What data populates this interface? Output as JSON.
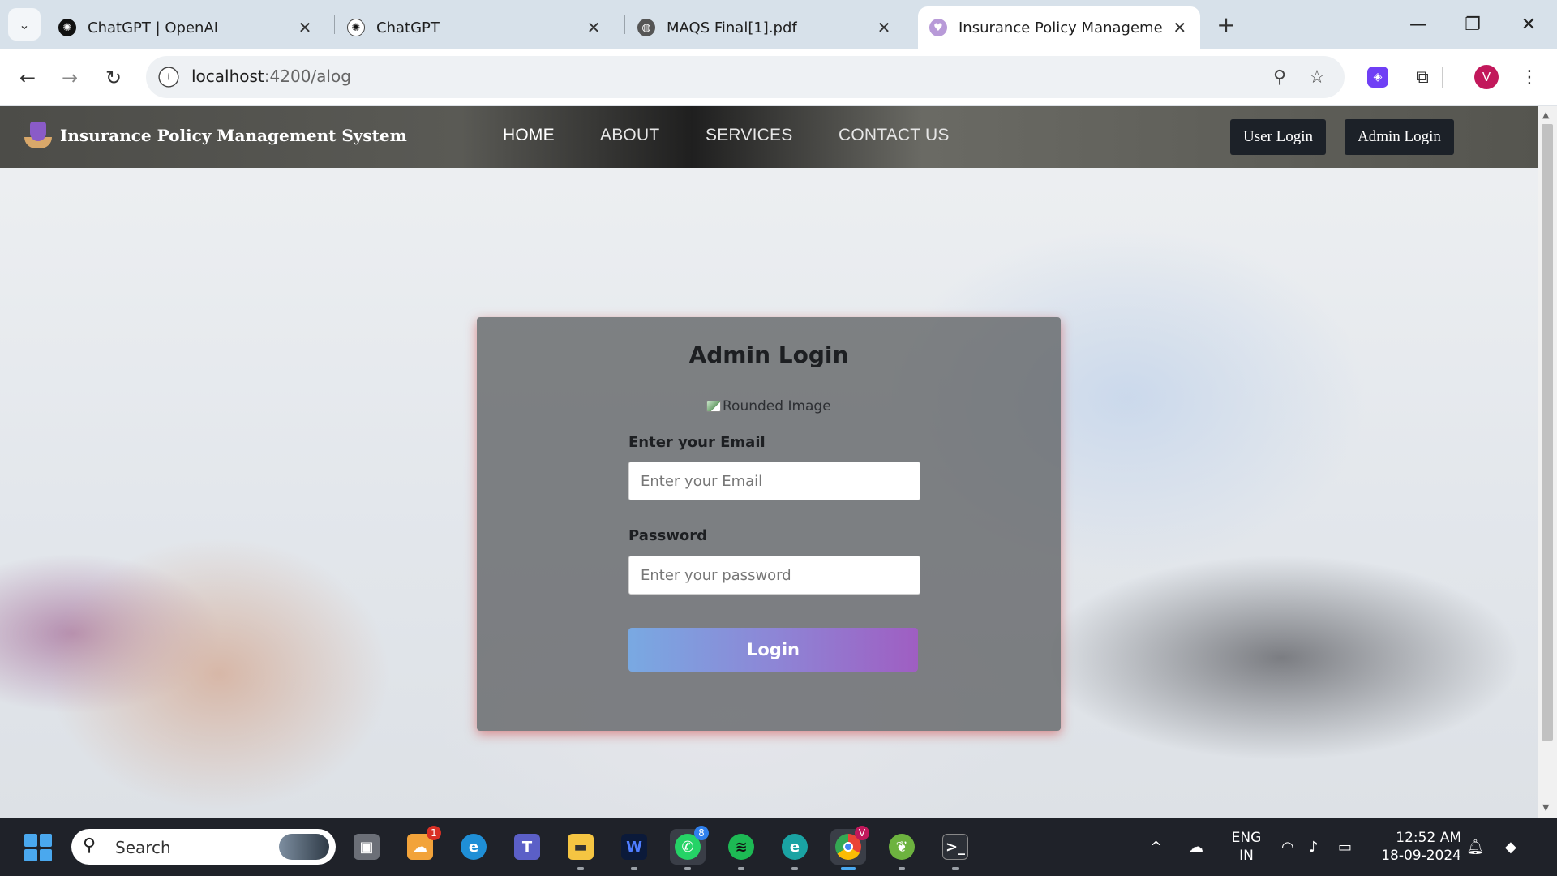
{
  "browser": {
    "tabs": [
      {
        "title": "ChatGPT | OpenAI",
        "icon": "chatgpt-icon",
        "active": false
      },
      {
        "title": "ChatGPT",
        "icon": "chatgpt-icon",
        "active": false
      },
      {
        "title": "MAQS Final[1].pdf",
        "icon": "globe-icon",
        "active": false
      },
      {
        "title": "Insurance Policy Management",
        "icon": "insurance-logo-icon",
        "active": true
      }
    ],
    "url_host": "localhost",
    "url_path": ":4200/alog",
    "profile_initial": "V"
  },
  "site": {
    "brand_title": "Insurance Policy Management System",
    "nav": [
      "HOME",
      "ABOUT",
      "SERVICES",
      "CONTACT US"
    ],
    "user_login_label": "User Login",
    "admin_login_label": "Admin Login"
  },
  "login": {
    "title": "Admin Login",
    "image_alt": "Rounded Image",
    "email_label": "Enter your Email",
    "email_placeholder": "Enter your Email",
    "password_label": "Password",
    "password_placeholder": "Enter your password",
    "submit_label": "Login"
  },
  "taskbar": {
    "search_label": "Search",
    "weather_badge": "1",
    "whatsapp_badge": "8",
    "chrome_badge": "V",
    "lang_line1": "ENG",
    "lang_line2": "IN",
    "time": "12:52 AM",
    "date": "18-09-2024"
  },
  "colors": {
    "accent_purple": "#6f3ff5",
    "profile": "#c2185b",
    "login_gradient_start": "#79a9e2",
    "login_gradient_end": "#9f5ec2"
  }
}
